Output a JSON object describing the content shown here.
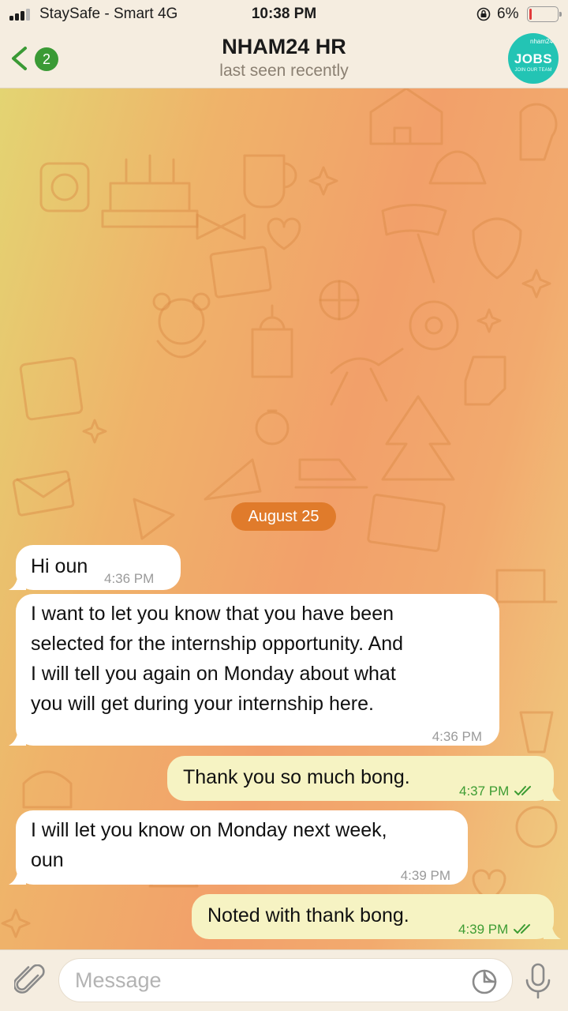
{
  "status_bar": {
    "carrier": "StaySafe - Smart  4G",
    "time": "10:38 PM",
    "battery_percent": "6%",
    "battery_level": 0.06,
    "battery_color": "#e23b3b",
    "icons": [
      "signal-icon",
      "orientation-lock-icon",
      "battery-icon"
    ]
  },
  "header": {
    "back_badge": "2",
    "title": "NHAM24 HR",
    "subtitle": "last seen recently",
    "avatar": {
      "small_text": "nham24",
      "text": "JOBS",
      "sub_text": "JOIN OUR TEAM",
      "color": "#23c4b4"
    },
    "icons": [
      "back-chevron-icon"
    ]
  },
  "chat": {
    "date_label": "August 25",
    "colors": {
      "incoming_bubble": "#ffffff",
      "outgoing_bubble": "#f6f3c3",
      "date_pill": "#e07b2b",
      "read_ticks": "#3d9c33"
    },
    "messages": [
      {
        "direction": "in",
        "lines": [
          "Hi oun"
        ],
        "time": "4:36 PM"
      },
      {
        "direction": "in",
        "lines": [
          "I want to let you know that you have been",
          "selected for the internship opportunity. And",
          "I will tell you again on Monday about what",
          "you will get during your internship here."
        ],
        "time": "4:36 PM"
      },
      {
        "direction": "out",
        "lines": [
          "Thank you so much bong."
        ],
        "time": "4:37 PM",
        "read": true
      },
      {
        "direction": "in",
        "lines": [
          "I will let you know on Monday next week,",
          "oun"
        ],
        "time": "4:39 PM"
      },
      {
        "direction": "out",
        "lines": [
          "Noted with thank bong."
        ],
        "time": "4:39 PM",
        "read": true
      }
    ]
  },
  "input_bar": {
    "placeholder": "Message",
    "icons": [
      "attachment-icon",
      "sticker-icon",
      "microphone-icon"
    ]
  }
}
